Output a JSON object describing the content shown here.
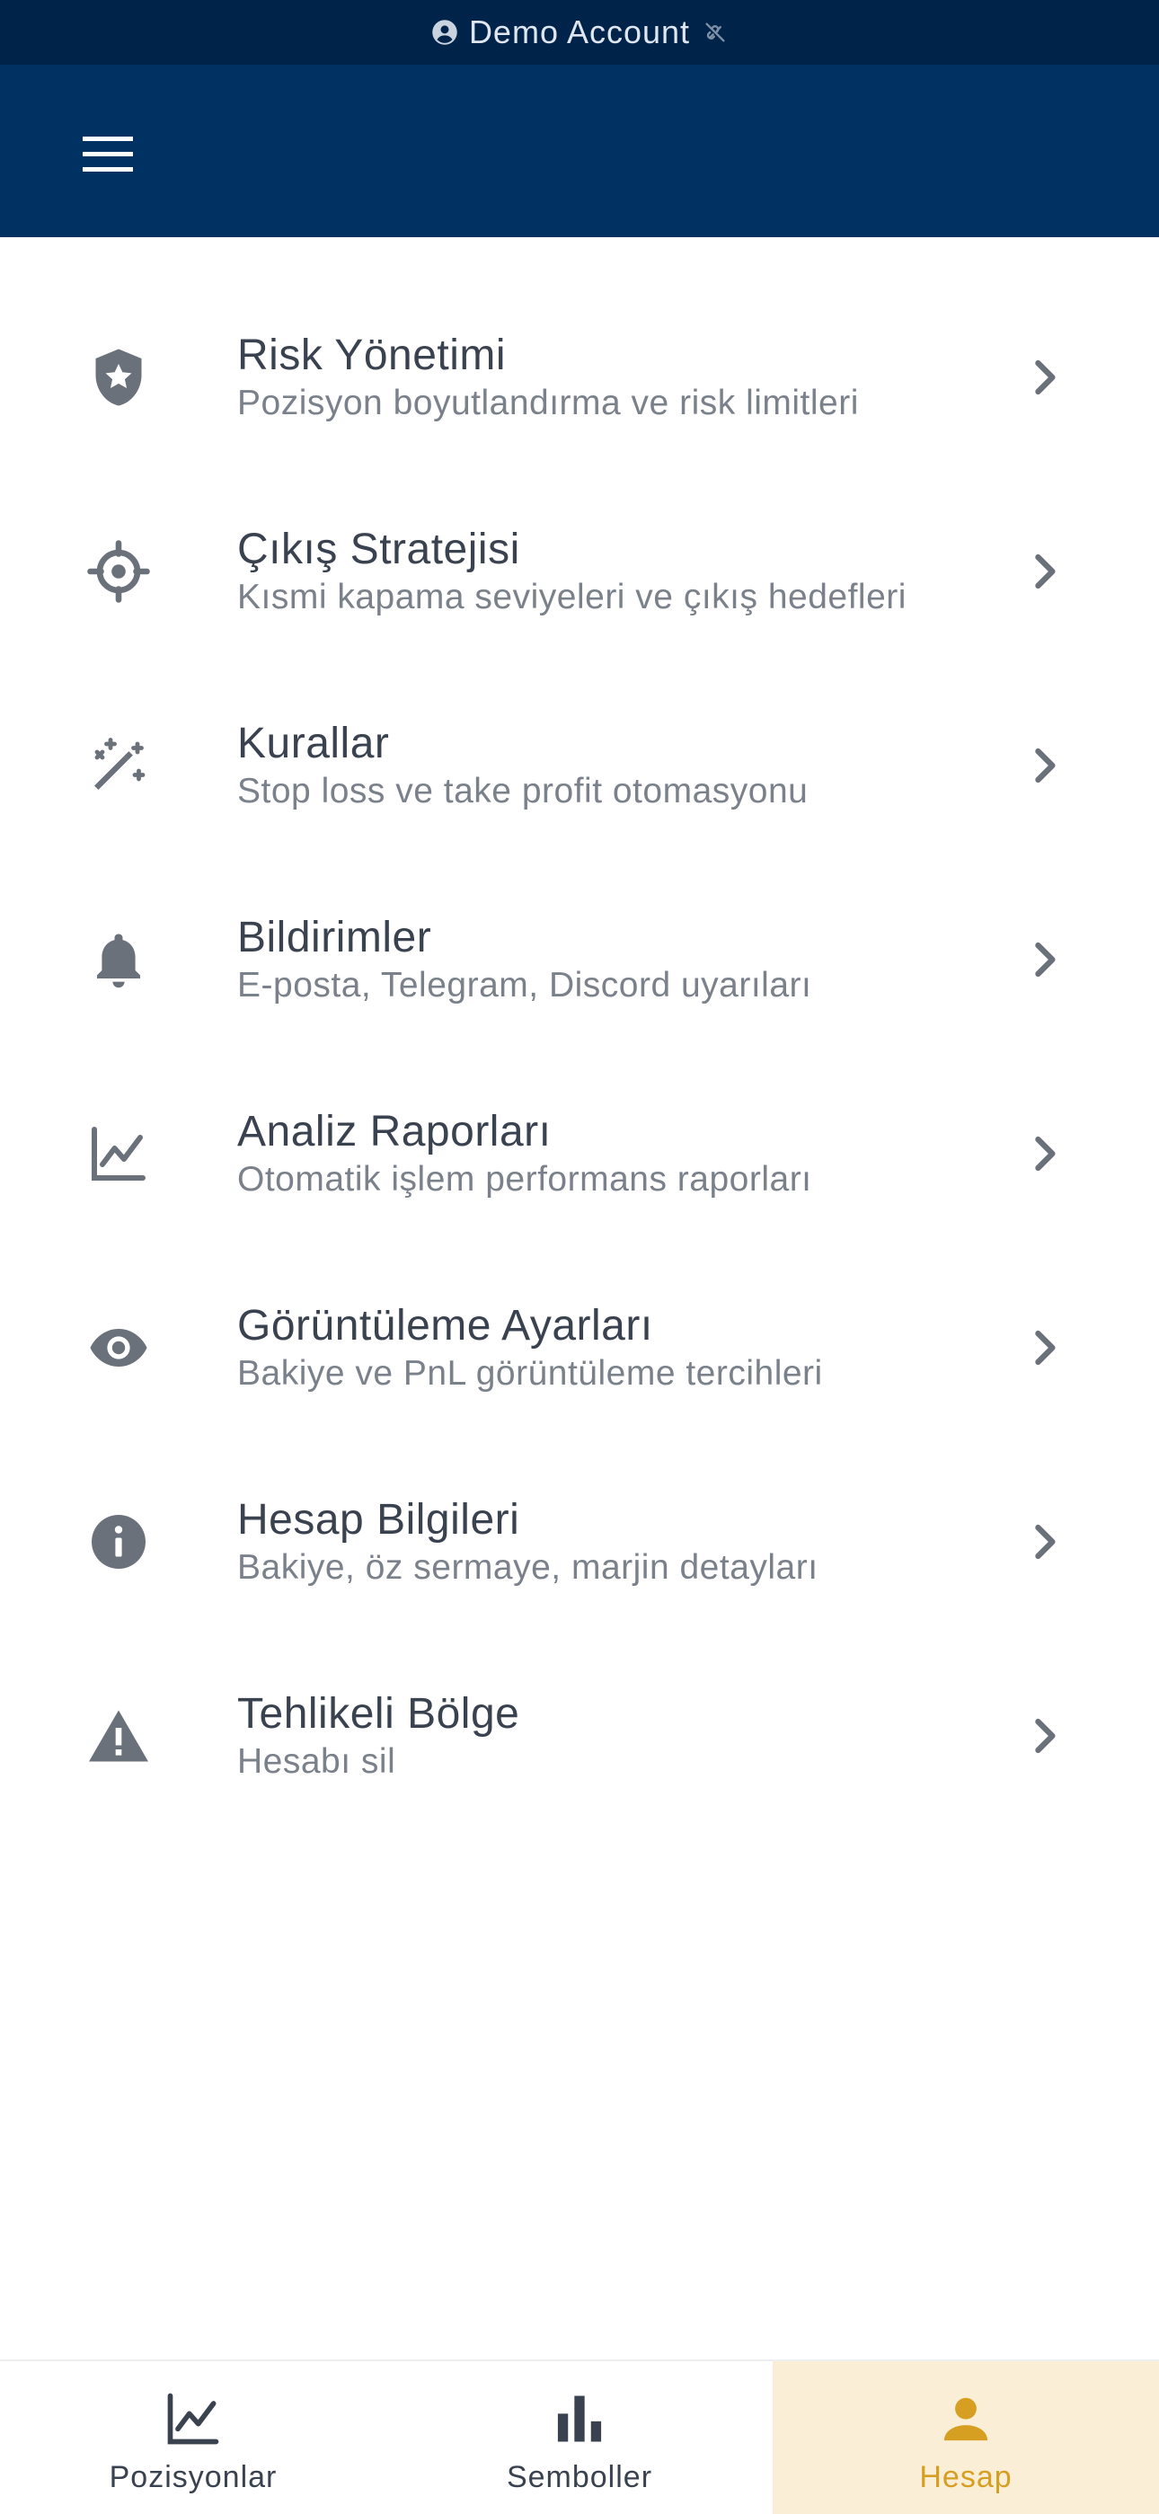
{
  "status_bar": {
    "text": "Demo Account",
    "icon": "account-circle-icon",
    "status_icon": "link-off-icon"
  },
  "app_bar": {
    "menu_icon": "menu-icon"
  },
  "menu": [
    {
      "id": "risk",
      "title": "Risk Yönetimi",
      "subtitle": "Pozisyon boyutlandırma ve risk limitleri",
      "icon": "shield-star-icon"
    },
    {
      "id": "exit",
      "title": "Çıkış Stratejisi",
      "subtitle": "Kısmi kapama seviyeleri ve çıkış hedefleri",
      "icon": "crosshair-icon"
    },
    {
      "id": "rules",
      "title": "Kurallar",
      "subtitle": "Stop loss ve take profit otomasyonu",
      "icon": "magic-wand-icon"
    },
    {
      "id": "notifications",
      "title": "Bildirimler",
      "subtitle": "E-posta, Telegram, Discord uyarıları",
      "icon": "bell-icon"
    },
    {
      "id": "reports",
      "title": "Analiz Raporları",
      "subtitle": "Otomatik işlem performans raporları",
      "icon": "line-chart-icon"
    },
    {
      "id": "display",
      "title": "Görüntüleme Ayarları",
      "subtitle": "Bakiye ve PnL görüntüleme tercihleri",
      "icon": "eye-icon"
    },
    {
      "id": "account",
      "title": "Hesap Bilgileri",
      "subtitle": "Bakiye, öz sermaye, marjin detayları",
      "icon": "info-icon"
    },
    {
      "id": "danger",
      "title": "Tehlikeli Bölge",
      "subtitle": "Hesabı sil",
      "icon": "warning-icon"
    }
  ],
  "bottom_nav": [
    {
      "label": "Pozisyonlar",
      "icon": "line-chart-icon",
      "active": false
    },
    {
      "label": "Semboller",
      "icon": "bar-chart-icon",
      "active": false
    },
    {
      "label": "Hesap",
      "icon": "person-icon",
      "active": true
    }
  ],
  "colors": {
    "status_bar": "#00234a",
    "app_bar": "#003163",
    "icon_gray": "#6b717b",
    "accent": "#d69f22",
    "active_tab_bg": "#fbeed6"
  }
}
